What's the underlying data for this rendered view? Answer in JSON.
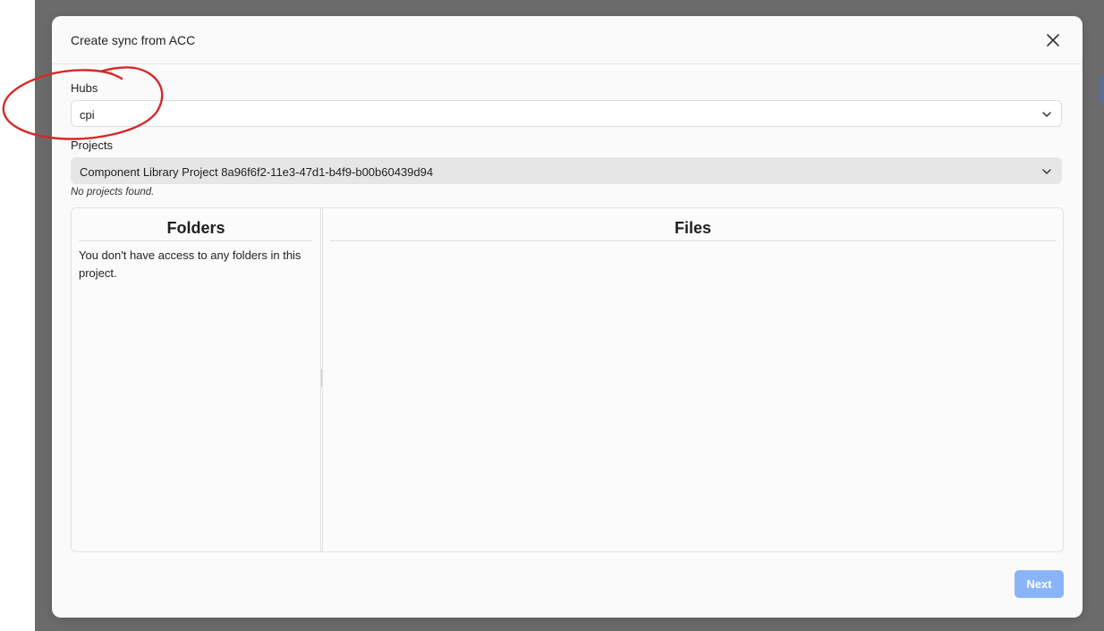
{
  "modal": {
    "title": "Create sync from ACC",
    "close_icon": "close-icon"
  },
  "hubs": {
    "label": "Hubs",
    "value": "cpi",
    "icon": "chevron-down-icon"
  },
  "projects": {
    "label": "Projects",
    "value": "Component Library Project 8a96f6f2-11e3-47d1-b4f9-b00b60439d94",
    "hint": "No projects found.",
    "icon": "chevron-down-icon"
  },
  "folders": {
    "title": "Folders",
    "message": "You don't have access to any folders in this project."
  },
  "files": {
    "title": "Files"
  },
  "footer": {
    "next_label": "Next"
  },
  "colors": {
    "backdrop": "#6b6b6b",
    "primary_disabled": "#8ab4f8",
    "annotation": "#d42a2a"
  }
}
